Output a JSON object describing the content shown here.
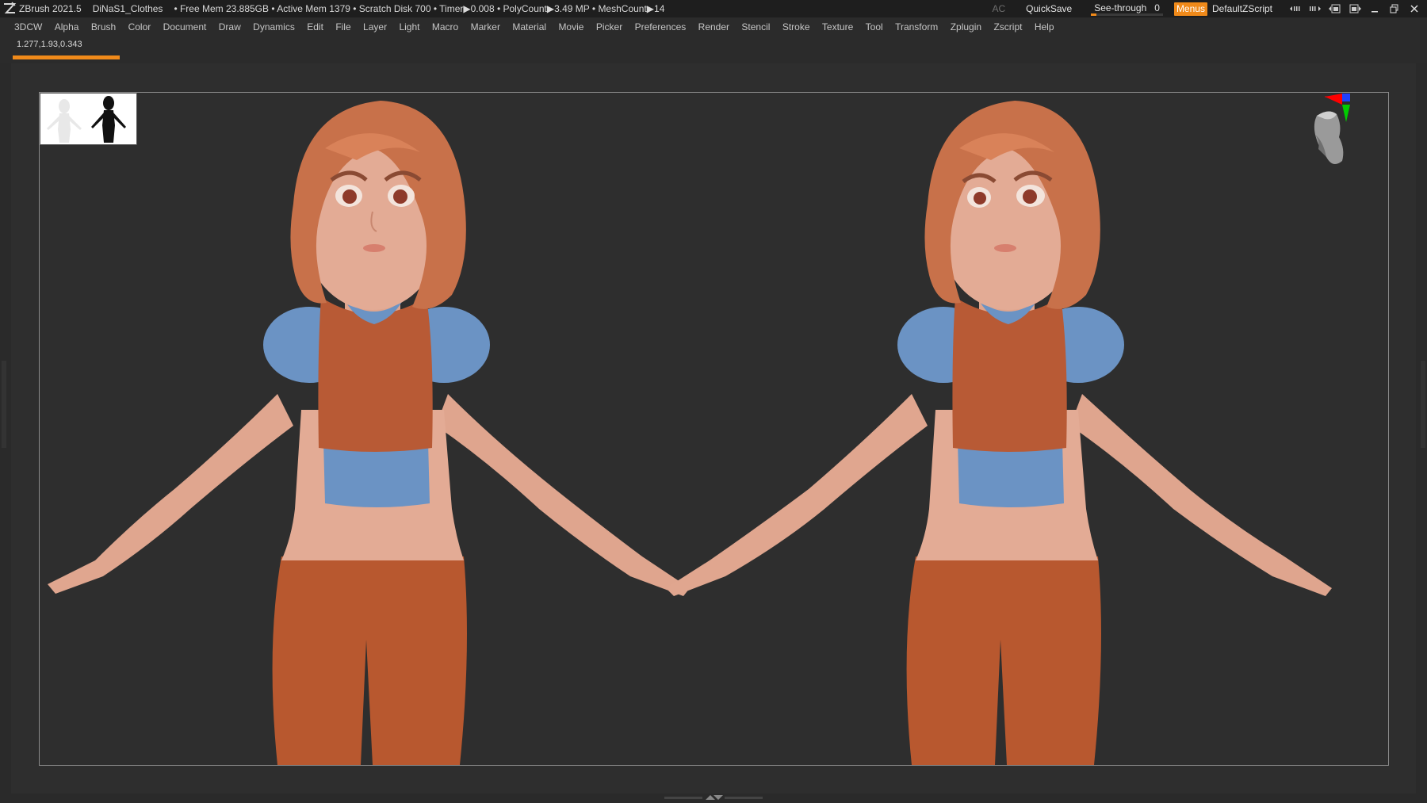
{
  "titlebar": {
    "app_name": "ZBrush 2021.5",
    "document_name": "DiNaS1_Clothes",
    "stats": "• Free Mem 23.885GB • Active Mem 1379 • Scratch Disk 700 •  Timer▶0.008 • PolyCount▶3.49 MP  • MeshCount▶14",
    "ac_label": "AC",
    "quicksave_label": "QuickSave",
    "see_through_label": "See-through",
    "see_through_value": "0",
    "see_through_level": 0.08,
    "menus_label": "Menus",
    "script_label": "DefaultZScript",
    "accent_color": "#f08a1a"
  },
  "menubar": {
    "items": [
      "3DCW",
      "Alpha",
      "Brush",
      "Color",
      "Document",
      "Draw",
      "Dynamics",
      "Edit",
      "File",
      "Layer",
      "Light",
      "Macro",
      "Marker",
      "Material",
      "Movie",
      "Picker",
      "Preferences",
      "Render",
      "Stencil",
      "Stroke",
      "Texture",
      "Tool",
      "Transform",
      "Zplugin",
      "Zscript",
      "Help"
    ]
  },
  "subbar": {
    "coordinates": "1.277,1.93,0.343"
  },
  "viewport": {
    "hair_color": "#c8714a",
    "skin_color": "#e3ab95",
    "top_color": "#b85a35",
    "sleeve_color": "#6b93c4",
    "pants_color": "#b8582f",
    "background_color": "#2e2e2e",
    "navcube": "head-gizmo",
    "axis_colors": [
      "#ff0000",
      "#00cc00",
      "#0000ff"
    ]
  }
}
